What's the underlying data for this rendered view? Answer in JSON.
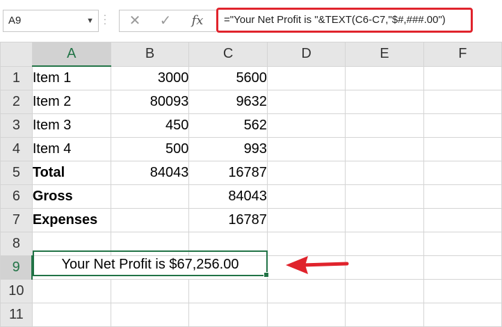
{
  "name_box": {
    "value": "A9",
    "dropdown_icon": "chevron-down-icon"
  },
  "formula_bar": {
    "cancel_icon": "close-icon",
    "enter_icon": "check-icon",
    "fx_label": "fx",
    "formula": "=\"Your Net Profit is \"&TEXT(C6-C7,\"$#,###.00\")"
  },
  "columns": [
    "A",
    "B",
    "C",
    "D",
    "E",
    "F"
  ],
  "rows": [
    {
      "num": "1",
      "a": "Item 1",
      "b": "3000",
      "c": "5600"
    },
    {
      "num": "2",
      "a": "Item 2",
      "b": "80093",
      "c": "9632"
    },
    {
      "num": "3",
      "a": "Item 3",
      "b": "450",
      "c": "562"
    },
    {
      "num": "4",
      "a": "Item 4",
      "b": "500",
      "c": "993"
    },
    {
      "num": "5",
      "a": "Total",
      "b": "84043",
      "c": "16787"
    },
    {
      "num": "6",
      "a": "Gross",
      "b": "",
      "c": "84043"
    },
    {
      "num": "7",
      "a": "Expenses",
      "b": "",
      "c": "16787"
    },
    {
      "num": "8",
      "a": "",
      "b": "",
      "c": ""
    },
    {
      "num": "9",
      "a": "Your Net Profit is $67,256.00",
      "b": "",
      "c": ""
    },
    {
      "num": "10",
      "a": "",
      "b": "",
      "c": ""
    },
    {
      "num": "11",
      "a": "",
      "b": "",
      "c": ""
    }
  ],
  "colors": {
    "accent_green": "#217346",
    "highlight_red": "#e0232c"
  }
}
